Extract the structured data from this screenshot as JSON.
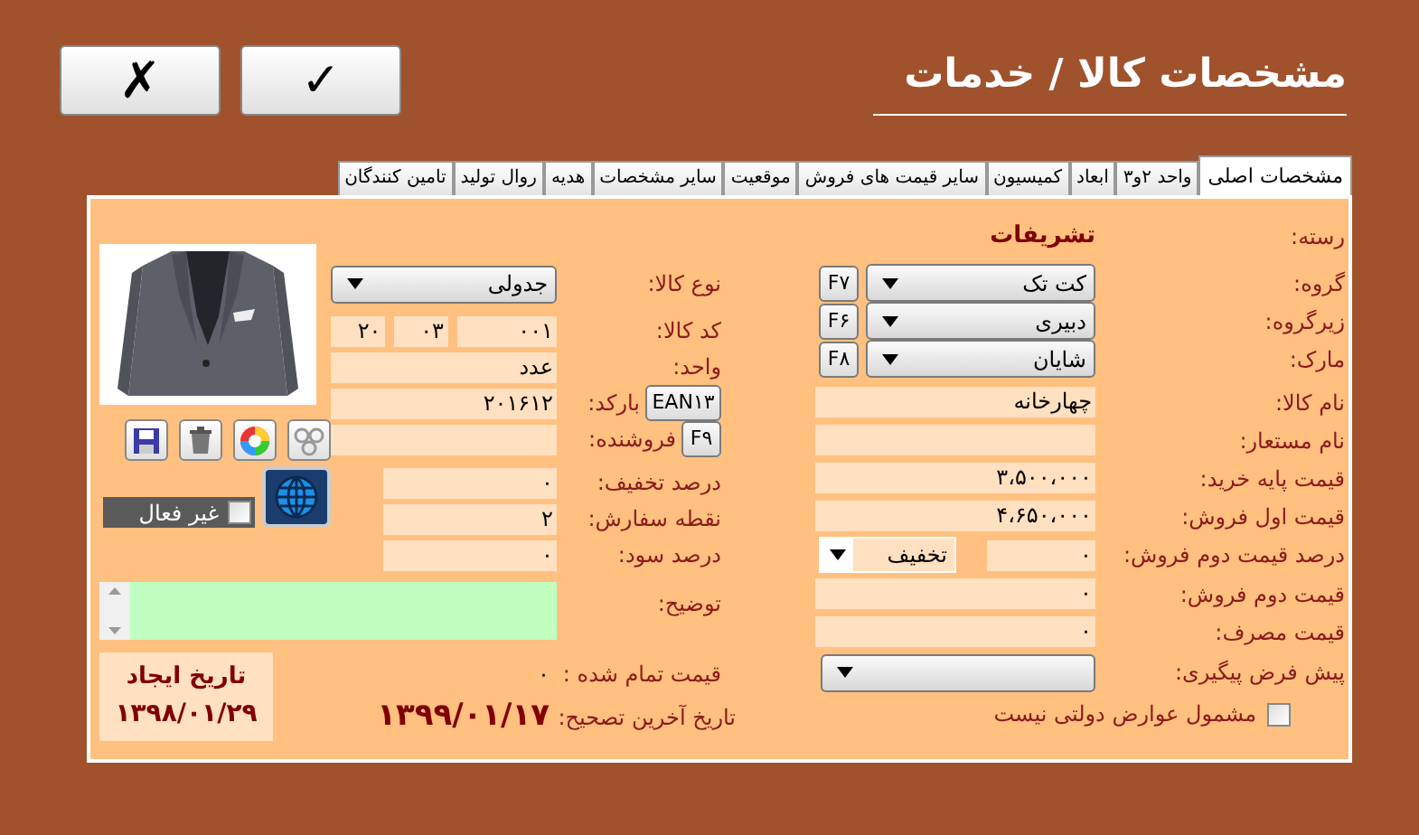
{
  "window": {
    "title": "مشخصات کالا / خدمات"
  },
  "toolbar_buttons": [
    {
      "kind": "confirm",
      "label": "✓"
    },
    {
      "kind": "cancel",
      "label": "✗"
    }
  ],
  "tabs": [
    {
      "label": "مشخصات اصلی",
      "selected": true
    },
    {
      "label": "واحد ۲و۳",
      "selected": false
    },
    {
      "label": "ابعاد",
      "selected": false
    },
    {
      "label": "کمیسیون",
      "selected": false
    },
    {
      "label": "سایر قیمت های فروش",
      "selected": false
    },
    {
      "label": "موقعیت",
      "selected": false
    },
    {
      "label": "سایر مشخصات",
      "selected": false
    },
    {
      "label": "هدیه",
      "selected": false
    },
    {
      "label": "روال تولید",
      "selected": false
    },
    {
      "label": "تامین کنندگان",
      "selected": false
    }
  ],
  "main_fields": [
    {
      "kind": "static",
      "label": "رسته:",
      "value": "تشریفات"
    },
    {
      "kind": "combo",
      "label": "گروه:",
      "value": "کت تک",
      "shortcut": "F۷"
    },
    {
      "kind": "combo",
      "label": "زیرگروه:",
      "value": "دبیری",
      "shortcut": "F۶"
    },
    {
      "kind": "combo",
      "label": "مارک:",
      "value": "شایان",
      "shortcut": "F۸"
    },
    {
      "kind": "text",
      "label": "نام کالا:",
      "value": "چهارخانه"
    },
    {
      "kind": "text",
      "label": "نام مستعار:"
    },
    {
      "kind": "text",
      "label": "قیمت پایه خرید:",
      "value": "۳،۵۰۰،۰۰۰"
    },
    {
      "kind": "text",
      "label": "قیمت اول فروش:",
      "value": "۴،۶۵۰،۰۰۰"
    },
    {
      "kind": "percent",
      "label": "درصد قیمت دوم فروش:",
      "value": "۰",
      "mode": "تخفیف"
    },
    {
      "kind": "text",
      "label": "قیمت دوم فروش:",
      "value": "۰"
    },
    {
      "kind": "text",
      "label": "قیمت مصرف:",
      "value": "۰"
    },
    {
      "kind": "combo",
      "label": "پیش فرض پیگیری:"
    },
    {
      "kind": "checkbox",
      "label": "مشمول عوارض دولتی نیست",
      "checked": false
    }
  ],
  "detail_fields": [
    {
      "kind": "combo",
      "label": "نوع کالا:",
      "value": "جدولی"
    },
    {
      "kind": "code",
      "label": "کد کالا:",
      "parts": [
        "۰۰۱",
        "۰۳",
        "۲۰"
      ]
    },
    {
      "kind": "text",
      "label": "واحد:",
      "value": "عدد"
    },
    {
      "kind": "text",
      "label": "بارکد:",
      "value": "۲۰۱۶۱۲",
      "button": "EAN۱۳"
    },
    {
      "kind": "text",
      "label": "فروشنده:",
      "button": "F۹"
    },
    {
      "kind": "short",
      "label": "درصد تخفیف:",
      "value": "۰"
    },
    {
      "kind": "short",
      "label": "نقطه سفارش:",
      "value": "۲"
    },
    {
      "kind": "short",
      "label": "درصد سود:",
      "value": "۰"
    }
  ],
  "inactive": {
    "label": "غیر فعال",
    "checked": false
  },
  "description": {
    "label": "توضیح:"
  },
  "finished_price": {
    "label": "قیمت تمام شده :",
    "value": "۰"
  },
  "last_edit": {
    "label": "تاریخ آخرین تصحیح:",
    "value": "۱۳۹۹/۰۱/۱۷"
  },
  "created": {
    "label": "تاریخ ایجاد",
    "value": "۱۳۹۸/۰۱/۲۹"
  }
}
